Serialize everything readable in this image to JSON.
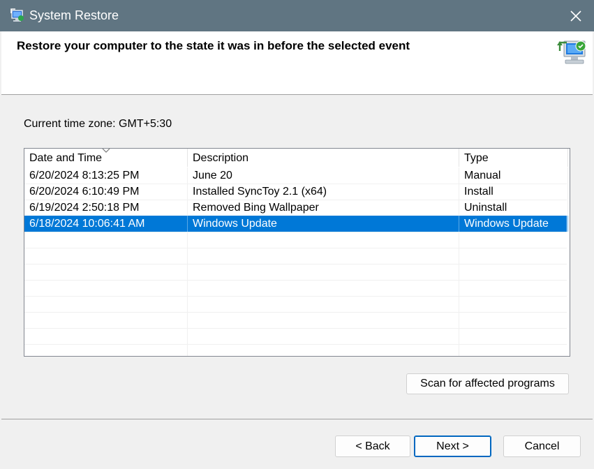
{
  "window": {
    "title": "System Restore",
    "close_icon": "close-icon",
    "app_icon": "system-restore-icon"
  },
  "header": {
    "title": "Restore your computer to the state it was in before the selected event",
    "icon": "system-restore-icon"
  },
  "timezone_label": "Current time zone: GMT+5:30",
  "restore_points": {
    "columns": [
      "Date and Time",
      "Description",
      "Type"
    ],
    "sorted_column": "Date and Time",
    "sort_direction": "descending",
    "rows": [
      {
        "date": "6/20/2024 8:13:25 PM",
        "description": "June 20",
        "type": "Manual",
        "selected": false
      },
      {
        "date": "6/20/2024 6:10:49 PM",
        "description": "Installed SyncToy 2.1 (x64)",
        "type": "Install",
        "selected": false
      },
      {
        "date": "6/19/2024 2:50:18 PM",
        "description": "Removed Bing Wallpaper",
        "type": "Uninstall",
        "selected": false
      },
      {
        "date": "6/18/2024 10:06:41 AM",
        "description": "Windows Update",
        "type": "Windows Update",
        "selected": true
      }
    ]
  },
  "buttons": {
    "scan": "Scan for affected programs",
    "back": "< Back",
    "next": "Next >",
    "cancel": "Cancel"
  },
  "colors": {
    "titlebar": "#607582",
    "selection": "#0078d7",
    "default_button_border": "#0067c0"
  }
}
